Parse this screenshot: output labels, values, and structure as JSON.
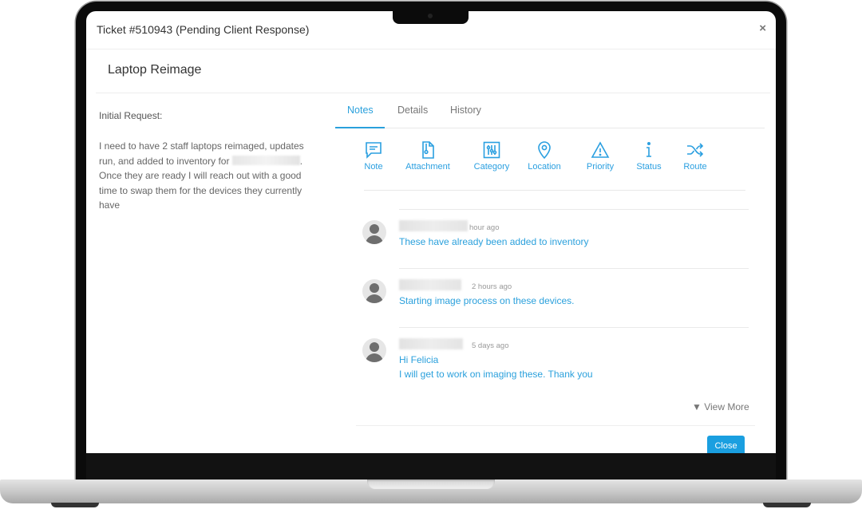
{
  "modal": {
    "title": "Ticket #510943 (Pending Client Response)",
    "close_icon": "×",
    "subject": "Laptop Reimage"
  },
  "initial_request": {
    "label": "Initial Request:",
    "text_before_redaction": "I need to have 2 staff laptops reimaged, updates run, and added to inventory for",
    "text_after_redaction": ". Once they are ready I will reach out with a good time to swap them for the devices they currently have"
  },
  "tabs": [
    {
      "label": "Notes",
      "active": true
    },
    {
      "label": "Details",
      "active": false
    },
    {
      "label": "History",
      "active": false
    }
  ],
  "actions": [
    {
      "label": "Note",
      "icon": "note-icon"
    },
    {
      "label": "Attachment",
      "icon": "attachment-icon"
    },
    {
      "label": "Category",
      "icon": "category-sliders-icon"
    },
    {
      "label": "Location",
      "icon": "location-pin-icon"
    },
    {
      "label": "Priority",
      "icon": "warning-triangle-icon"
    },
    {
      "label": "Status",
      "icon": "info-icon"
    },
    {
      "label": "Route",
      "icon": "shuffle-icon"
    }
  ],
  "notes": [
    {
      "time": "hour ago",
      "lines": [
        "These have already been added to inventory"
      ]
    },
    {
      "time": "2 hours ago",
      "lines": [
        "Starting image process on these devices."
      ]
    },
    {
      "time": "5 days ago",
      "lines": [
        "Hi Felicia",
        "I will get to work on imaging these. Thank you"
      ]
    }
  ],
  "view_more": "▼ View More",
  "close_button": "Close",
  "colors": {
    "accent": "#2aa0dc",
    "button": "#1a9fe0"
  }
}
